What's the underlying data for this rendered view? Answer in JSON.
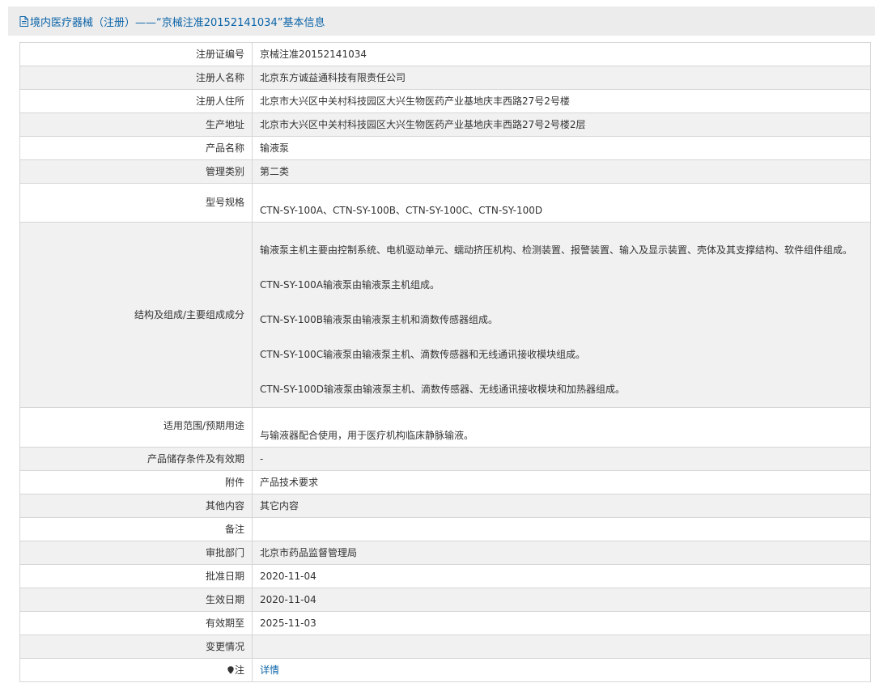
{
  "title": {
    "icon": "document-icon",
    "text": "境内医疗器械（注册）——“京械注准20152141034”基本信息"
  },
  "colors": {
    "title_text": "#0a63a8",
    "title_bg": "#ececec",
    "row_alt_bg": "#f1f1f1",
    "border": "#d6d6d6",
    "link": "#0a63a8"
  },
  "rows": [
    {
      "label": "注册证编号",
      "value": "京械注准20152141034"
    },
    {
      "label": "注册人名称",
      "value": "北京东方诚益通科技有限责任公司"
    },
    {
      "label": "注册人住所",
      "value": "北京市大兴区中关村科技园区大兴生物医药产业基地庆丰西路27号2号楼"
    },
    {
      "label": "生产地址",
      "value": "北京市大兴区中关村科技园区大兴生物医药产业基地庆丰西路27号2号楼2层"
    },
    {
      "label": "产品名称",
      "value": "输液泵"
    },
    {
      "label": "管理类别",
      "value": "第二类"
    },
    {
      "label": "型号规格",
      "value": "CTN-SY-100A、CTN-SY-100B、CTN-SY-100C、CTN-SY-100D"
    },
    {
      "label": "结构及组成/主要组成成分",
      "paragraphs": [
        "输液泵主机主要由控制系统、电机驱动单元、蠕动挤压机构、检测装置、报警装置、输入及显示装置、壳体及其支撑结构、软件组件组成。",
        "CTN-SY-100A输液泵由输液泵主机组成。",
        "CTN-SY-100B输液泵由输液泵主机和滴数传感器组成。",
        "CTN-SY-100C输液泵由输液泵主机、滴数传感器和无线通讯接收模块组成。",
        "CTN-SY-100D输液泵由输液泵主机、滴数传感器、无线通讯接收模块和加热器组成。"
      ]
    },
    {
      "label": "适用范围/预期用途",
      "value": "与输液器配合使用，用于医疗机构临床静脉输液。"
    },
    {
      "label": "产品储存条件及有效期",
      "value": "-"
    },
    {
      "label": "附件",
      "value": "产品技术要求"
    },
    {
      "label": "其他内容",
      "value": "其它内容"
    },
    {
      "label": "备注",
      "value": ""
    },
    {
      "label": "审批部门",
      "value": "北京市药品监督管理局"
    },
    {
      "label": "批准日期",
      "value": "2020-11-04"
    },
    {
      "label": "生效日期",
      "value": "2020-11-04"
    },
    {
      "label": "有效期至",
      "value": "2025-11-03"
    },
    {
      "label": "变更情况",
      "value": ""
    },
    {
      "label": "注",
      "label_icon": "location-pin-icon",
      "value": "详情"
    }
  ]
}
